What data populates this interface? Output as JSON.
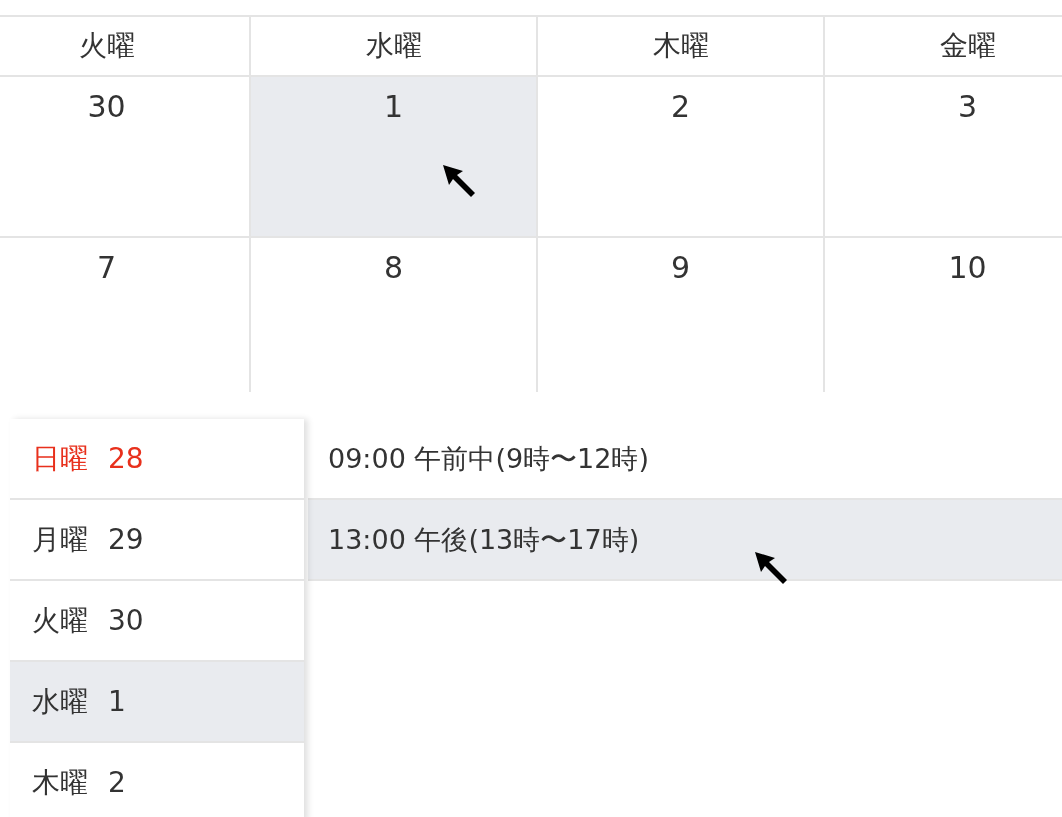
{
  "calendar": {
    "weekdays": [
      "火曜",
      "水曜",
      "木曜",
      "金曜"
    ],
    "weeks": [
      [
        {
          "day": "30",
          "selected": false
        },
        {
          "day": "1",
          "selected": true
        },
        {
          "day": "2",
          "selected": false
        },
        {
          "day": "3",
          "selected": false
        }
      ],
      [
        {
          "day": "7",
          "selected": false
        },
        {
          "day": "8",
          "selected": false
        },
        {
          "day": "9",
          "selected": false
        },
        {
          "day": "10",
          "selected": false
        }
      ]
    ]
  },
  "day_list": [
    {
      "weekday": "日曜",
      "day": "28",
      "kind": "sunday",
      "selected": false
    },
    {
      "weekday": "月曜",
      "day": "29",
      "kind": "weekday",
      "selected": false
    },
    {
      "weekday": "火曜",
      "day": "30",
      "kind": "weekday",
      "selected": false
    },
    {
      "weekday": "水曜",
      "day": "1",
      "kind": "weekday",
      "selected": true
    },
    {
      "weekday": "木曜",
      "day": "2",
      "kind": "weekday",
      "selected": false
    }
  ],
  "time_slots": [
    {
      "label": "09:00 午前中(9時〜12時)",
      "selected": false
    },
    {
      "label": "13:00 午後(13時〜17時)",
      "selected": true
    }
  ]
}
